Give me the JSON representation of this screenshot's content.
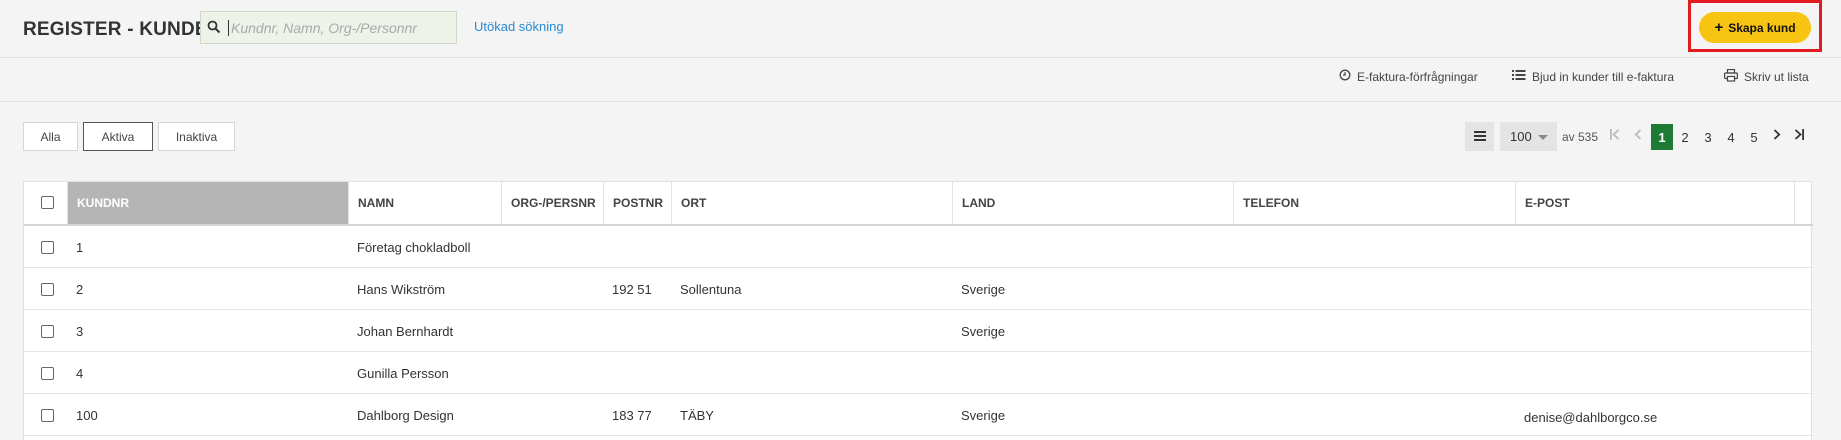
{
  "header": {
    "title": "REGISTER - KUNDER",
    "search_placeholder": "Kundnr, Namn, Org-/Personnr",
    "advanced_search": "Utökad sökning",
    "create_label": "Skapa kund",
    "accent_color": "#f7c411",
    "highlight_color": "#e01b22"
  },
  "actions": [
    {
      "label": "E-faktura-förfrågningar",
      "icon": "clock-icon"
    },
    {
      "label": "Bjud in kunder till e-faktura",
      "icon": "list-icon"
    },
    {
      "label": "Skriv ut lista",
      "icon": "printer-icon"
    }
  ],
  "filters": [
    {
      "label": "Alla",
      "active": false
    },
    {
      "label": "Aktiva",
      "active": true
    },
    {
      "label": "Inaktiva",
      "active": false
    }
  ],
  "pagination": {
    "page_size": "100",
    "total_text": "av 535",
    "pages": [
      "1",
      "2",
      "3",
      "4",
      "5"
    ],
    "current_page": "1",
    "current_color": "#1e7a34"
  },
  "table": {
    "columns": [
      "KUNDNR",
      "NAMN",
      "ORG-/PERSNR",
      "POSTNR",
      "ORT",
      "LAND",
      "TELEFON",
      "E-POST"
    ],
    "sorted_column": "KUNDNR",
    "rows": [
      {
        "kundnr": "1",
        "namn": "Företag chokladboll",
        "org": "",
        "postnr": "",
        "ort": "",
        "land": "",
        "telefon": "",
        "epost": ""
      },
      {
        "kundnr": "2",
        "namn": "Hans Wikström",
        "org": "",
        "postnr": "192 51",
        "ort": "Sollentuna",
        "land": "Sverige",
        "telefon": "",
        "epost": ""
      },
      {
        "kundnr": "3",
        "namn": "Johan Bernhardt",
        "org": "",
        "postnr": "",
        "ort": "",
        "land": "Sverige",
        "telefon": "",
        "epost": ""
      },
      {
        "kundnr": "4",
        "namn": "Gunilla Persson",
        "org": "",
        "postnr": "",
        "ort": "",
        "land": "",
        "telefon": "",
        "epost": ""
      },
      {
        "kundnr": "100",
        "namn": "Dahlborg Design",
        "org": "",
        "postnr": "183 77",
        "ort": "TÄBY",
        "land": "Sverige",
        "telefon": "",
        "epost": "denise@dahlborgco.se"
      }
    ]
  }
}
